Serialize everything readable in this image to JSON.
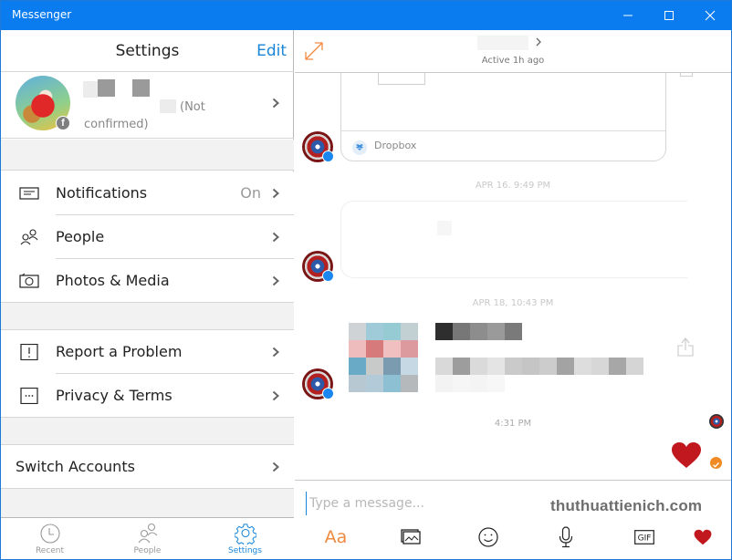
{
  "window": {
    "title": "Messenger",
    "controls": {
      "minimize": "minimize",
      "maximize": "maximize",
      "close": "close"
    }
  },
  "settings": {
    "header_title": "Settings",
    "edit_label": "Edit",
    "profile": {
      "status_text": "(Not confirmed)",
      "badge_icon": "facebook-icon"
    },
    "groups": [
      {
        "items": [
          {
            "label": "Notifications",
            "value": "On",
            "icon": "notifications-icon"
          },
          {
            "label": "People",
            "value": "",
            "icon": "people-icon"
          },
          {
            "label": "Photos & Media",
            "value": "",
            "icon": "camera-icon"
          }
        ]
      },
      {
        "items": [
          {
            "label": "Report a Problem",
            "value": "",
            "icon": "report-problem-icon"
          },
          {
            "label": "Privacy & Terms",
            "value": "",
            "icon": "privacy-terms-icon"
          }
        ]
      },
      {
        "items": [
          {
            "label": "Switch Accounts",
            "value": ""
          }
        ]
      }
    ]
  },
  "bottom_tabs": [
    {
      "label": "Recent",
      "icon": "clock-icon",
      "active": false
    },
    {
      "label": "People",
      "icon": "people-icon",
      "active": false
    },
    {
      "label": "Settings",
      "icon": "gear-icon",
      "active": true
    }
  ],
  "chat": {
    "header": {
      "status": "Active 1h ago"
    },
    "messages": {
      "link_card": {
        "source": "Dropbox"
      },
      "timestamps": [
        "APR 16, 9:49 PM",
        "APR 18, 10:43 PM",
        "4:31 PM"
      ]
    },
    "composer": {
      "placeholder": "Type a message...",
      "value": "",
      "watermark": "thuthuattienich.com",
      "tools": [
        {
          "label": "Aa",
          "icon": "text-format-icon"
        },
        {
          "label": "",
          "icon": "image-gallery-icon"
        },
        {
          "label": "",
          "icon": "emoji-icon"
        },
        {
          "label": "",
          "icon": "microphone-icon"
        },
        {
          "label": "GIF",
          "icon": "gif-icon"
        },
        {
          "label": "",
          "icon": "heart-icon"
        }
      ]
    }
  },
  "colors": {
    "titlebar": "#0a7cf0",
    "accent_blue": "#1a86d9",
    "accent_orange": "#f08a40",
    "heart_red": "#c0181e",
    "separator": "#d6d6d6",
    "group_gap": "#f2f2f2"
  }
}
